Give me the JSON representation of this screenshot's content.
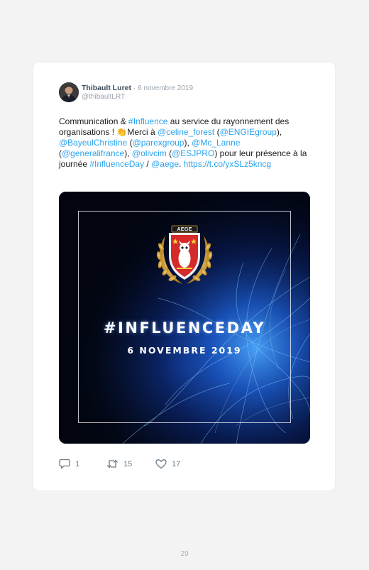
{
  "tweet": {
    "author_name": "Thibault Luret",
    "separator": "·",
    "date": "6 novembre 2019",
    "handle": "@thibaultLRT",
    "text": {
      "p1": "Communication & ",
      "hashtag_influence": "#Influence",
      "p2": " au service du rayonnement des organisations ! ",
      "emoji": "👏",
      "p3": "Merci à ",
      "m_celine": "@celine_forest",
      "p4": " (",
      "m_engie": "@ENGIEgroup",
      "p5": "), ",
      "m_bayeul": "@BayeulChristine",
      "p6": " (",
      "m_parex": "@parexgroup",
      "p7": "), ",
      "m_lanne": "@Mc_Lanne",
      "p8": " (",
      "m_generali": "@generalifrance",
      "p9": "), ",
      "m_olivcim": "@olivcim",
      "p10": " (",
      "m_esjpro": "@ESJPRO",
      "p11": ") pour leur présence à la journée ",
      "hashtag_day": "#InfluenceDay",
      "p12": " / ",
      "m_aege": "@aege",
      "p13": ". ",
      "link": "https://t.co/yxSLz5kncg"
    },
    "media": {
      "badge_text": "AEGE",
      "headline": "#INFLUENCEDAY",
      "event_date": "6 NOVEMBRE 2019"
    },
    "actions": {
      "replies": "1",
      "retweets": "15",
      "likes": "17"
    }
  },
  "page_number": "29",
  "colors": {
    "link": "#2aa3ef",
    "background": "#f3f3f3",
    "card": "#ffffff",
    "shield_red": "#d42a2a",
    "laurel_gold": "#d8a830"
  }
}
